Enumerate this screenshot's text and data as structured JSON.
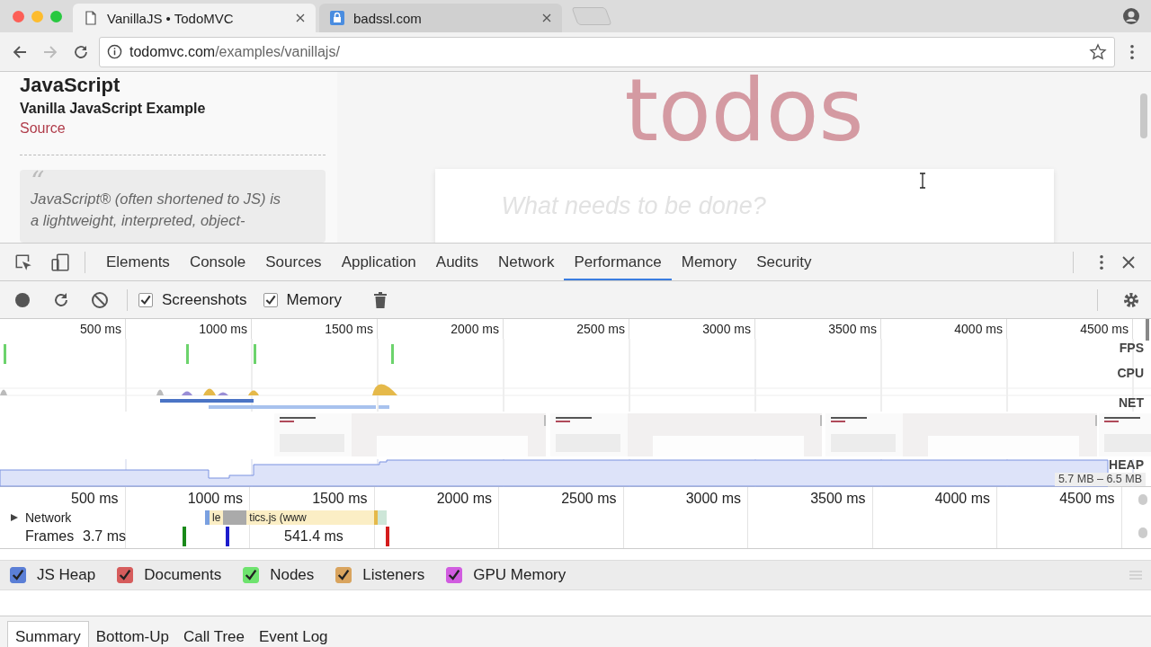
{
  "browser_tabs": [
    {
      "title": "VanillaJS • TodoMVC",
      "selected": true,
      "kind": "page"
    },
    {
      "title": "badssl.com",
      "selected": false,
      "kind": "lock"
    }
  ],
  "address": {
    "host": "todomvc.com",
    "path": "/examples/vanillajs/"
  },
  "page": {
    "heading": "JavaScript",
    "subtitle": "Vanilla JavaScript Example",
    "link": "Source",
    "quote_mark": "“",
    "quote_lines": [
      "JavaScript® (often shortened to JS) is",
      "a lightweight, interpreted, object-"
    ],
    "app_title": "todos",
    "new_todo_placeholder": "What needs to be done?"
  },
  "devtools": {
    "tabs": [
      {
        "label": "Elements",
        "selected": false
      },
      {
        "label": "Console",
        "selected": false
      },
      {
        "label": "Sources",
        "selected": false
      },
      {
        "label": "Application",
        "selected": false
      },
      {
        "label": "Audits",
        "selected": false
      },
      {
        "label": "Network",
        "selected": false
      },
      {
        "label": "Performance",
        "selected": true
      },
      {
        "label": "Memory",
        "selected": false
      },
      {
        "label": "Security",
        "selected": false
      }
    ],
    "toolbar": [
      {
        "label": "Screenshots",
        "checked": true
      },
      {
        "label": "Memory",
        "checked": true
      }
    ],
    "overview": {
      "ticks": [
        "500 ms",
        "1000 ms",
        "1500 ms",
        "2000 ms",
        "2500 ms",
        "3000 ms",
        "3500 ms",
        "4000 ms",
        "4500 ms"
      ],
      "tracks": [
        "FPS",
        "CPU",
        "NET",
        "HEAP"
      ],
      "heap_range": "5.7 MB – 6.5 MB"
    },
    "timeline": {
      "ticks": [
        "500 ms",
        "1000 ms",
        "1500 ms",
        "2000 ms",
        "2500 ms",
        "3000 ms",
        "3500 ms",
        "4000 ms",
        "4500 ms"
      ],
      "network_label": "Network",
      "network_items": [
        "le",
        "tics.js (www"
      ],
      "frames_label": "Frames",
      "frames": [
        "3.7 ms",
        "541.4 ms"
      ]
    },
    "counters": [
      {
        "label": "JS Heap",
        "checked": true,
        "color": "#5b7fd6"
      },
      {
        "label": "Documents",
        "checked": true,
        "color": "#d65c5c"
      },
      {
        "label": "Nodes",
        "checked": true,
        "color": "#6ee36e"
      },
      {
        "label": "Listeners",
        "checked": true,
        "color": "#d9a45e"
      },
      {
        "label": "GPU Memory",
        "checked": true,
        "color": "#d15ce0"
      }
    ],
    "detail_tabs": [
      {
        "label": "Summary",
        "selected": true
      },
      {
        "label": "Bottom-Up",
        "selected": false
      },
      {
        "label": "Call Tree",
        "selected": false
      },
      {
        "label": "Event Log",
        "selected": false
      }
    ]
  }
}
